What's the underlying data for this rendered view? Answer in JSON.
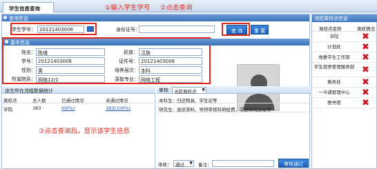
{
  "topbar": {
    "tab": "学生信息查询",
    "ann1": "①输入学生学号",
    "ann2": "②点击查询"
  },
  "query": {
    "header": "查询信息",
    "student_no_label": "学生学号：",
    "student_no_value": "20121403006",
    "id_label": "身份证号：",
    "id_value": "",
    "search_btn": "查 询",
    "reset_btn": "重 置"
  },
  "basic": {
    "header": "基本信息",
    "name_label": "姓名：",
    "name_value": "陈缮",
    "ethnicity_label": "民族：",
    "ethnicity_value": "汉族",
    "sno_label": "学号：",
    "sno_value": "20121403006",
    "idcard_label": "证件号：",
    "idcard_value": "20121403006",
    "gender_label": "性别：",
    "gender_value": "男",
    "level_label": "培养层次：",
    "level_value": "本科",
    "college_label": "所属院系：",
    "college_value": "网络12/1",
    "major_label": "录取专业：",
    "major_value": "网络工程"
  },
  "stats": {
    "header": "该生所在流程数据统计",
    "cols": [
      "离校点",
      "总人数",
      "已通过情况",
      "未通过情况"
    ],
    "row": [
      "学院",
      "383",
      "0(0%)",
      "383(100%)"
    ]
  },
  "audit": {
    "label": "审核",
    "select_value": "当前离校点",
    "line1": "本科生：归还物具、学生证等",
    "line2": "研究生：退还资料，导师审核科研经费、交还研究生证等",
    "bottom_label": "审核：",
    "bottom_select": "通过",
    "remark_label": "备注：",
    "remark_value": "",
    "approve_btn": "审核通过"
  },
  "annotation3": "③点击查询后，显示该学生信息",
  "side": {
    "header": "流程离校点信息",
    "col1": "离校点名称",
    "col2": "离校情况",
    "items": [
      {
        "name": "学院",
        "status": "x-icon"
      },
      {
        "name": "计划处",
        "status": "x-icon"
      },
      {
        "name": "党委学生工作部",
        "status": "x-icon"
      },
      {
        "name": "学生宿舍管理服务部",
        "status": "x-icon"
      },
      {
        "name": "教务处",
        "status": "x-icon"
      },
      {
        "name": "一卡通管理中心",
        "status": "x-icon"
      },
      {
        "name": "图书馆",
        "status": "x-icon"
      }
    ]
  },
  "colors": {
    "accent": "#3a73bd",
    "annotation": "#e0281b",
    "fail": "#c8141e"
  }
}
